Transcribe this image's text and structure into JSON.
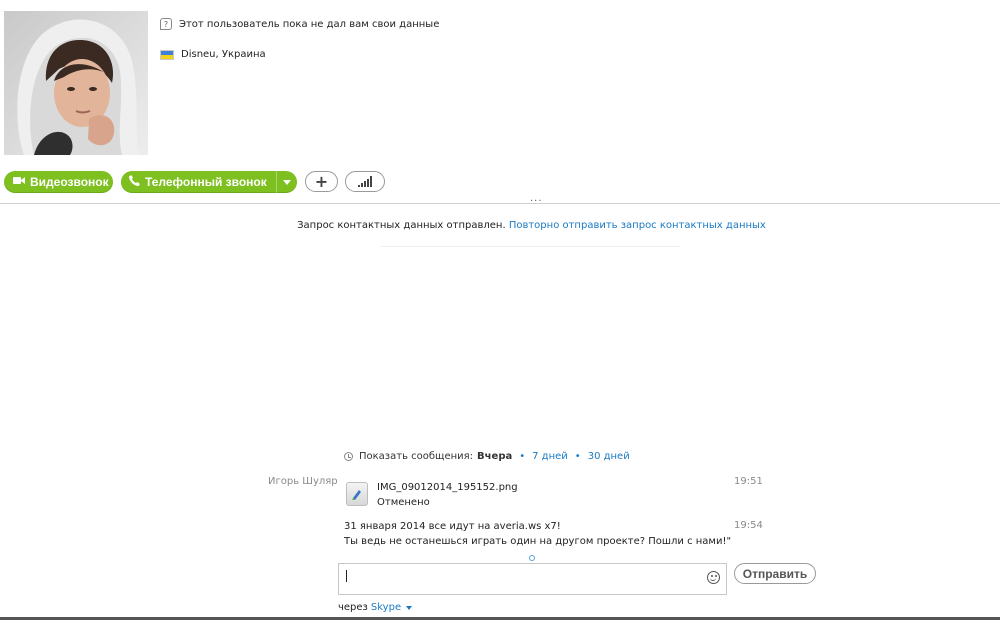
{
  "profile": {
    "status_text": "Этот пользователь пока не дал вам свои данные",
    "location": "Disneu, Украина",
    "flag_colors": [
      "#3f7fd6",
      "#f4d21c"
    ]
  },
  "actions": {
    "video_call_label": "Видеозвонок",
    "phone_call_label": "Телефонный звонок",
    "ellipsis": "..."
  },
  "request": {
    "sent_text": "Запрос контактных данных отправлен.",
    "resend_link": "Повторно отправить запрос контактных данных"
  },
  "history": {
    "label": "Показать сообщения:",
    "current": "Вчера",
    "options": [
      "7 дней",
      "30 дней"
    ]
  },
  "messages": [
    {
      "sender": "Игорь Шуляр",
      "file_name": "IMG_09012014_195152.png",
      "file_status": "Отменено",
      "time": "19:51"
    },
    {
      "line1": "31 января 2014 все идут на averia.ws x7!",
      "line2": "Ты ведь не останешься играть один на другом проекте? Пошли с нами!\"",
      "time": "19:54"
    }
  ],
  "compose": {
    "send_label": "Отправить",
    "via_prefix": "через",
    "via_service": "Skype"
  },
  "colors": {
    "accent_green": "#7dc01f",
    "link_blue": "#1a7ac4"
  }
}
